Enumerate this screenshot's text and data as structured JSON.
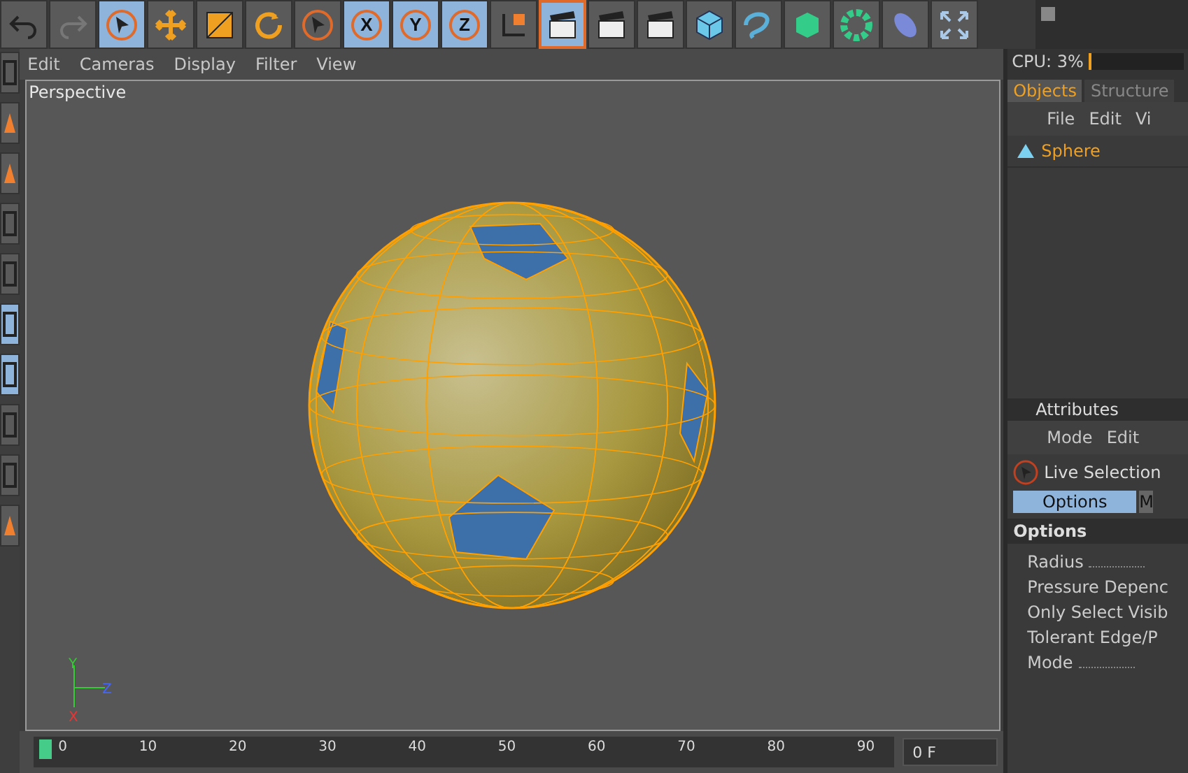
{
  "toolbar": {
    "buttons": [
      {
        "kind": "undo",
        "selected": false
      },
      {
        "kind": "redo",
        "selected": false
      },
      {
        "kind": "select",
        "selected": true
      },
      {
        "kind": "move",
        "selected": false
      },
      {
        "kind": "scale",
        "selected": false
      },
      {
        "kind": "rotate",
        "selected": false
      },
      {
        "kind": "select",
        "selected": false
      },
      {
        "kind": "axis-x",
        "selected": true,
        "label": "X"
      },
      {
        "kind": "axis-y",
        "selected": true,
        "label": "Y"
      },
      {
        "kind": "axis-z",
        "selected": true,
        "label": "Z"
      },
      {
        "kind": "coords",
        "selected": false
      },
      {
        "kind": "render",
        "selected": true
      },
      {
        "kind": "render",
        "selected": false
      },
      {
        "kind": "render",
        "selected": false
      },
      {
        "kind": "cube",
        "selected": false
      },
      {
        "kind": "spline",
        "selected": false
      },
      {
        "kind": "nurbs",
        "selected": false
      },
      {
        "kind": "array",
        "selected": false
      },
      {
        "kind": "deformer",
        "selected": false
      },
      {
        "kind": "expand",
        "selected": false
      }
    ]
  },
  "left_toolbar": {
    "buttons": [
      {
        "kind": "grid",
        "selected": false
      },
      {
        "kind": "cone",
        "selected": false
      },
      {
        "kind": "cone",
        "selected": false
      },
      {
        "kind": "grid",
        "selected": false
      },
      {
        "kind": "grid",
        "selected": false
      },
      {
        "kind": "grid",
        "selected": true
      },
      {
        "kind": "grid",
        "selected": true
      },
      {
        "kind": "grid",
        "selected": false
      },
      {
        "kind": "grid",
        "selected": false
      },
      {
        "kind": "cone",
        "selected": false
      }
    ]
  },
  "viewport": {
    "menu": [
      "Edit",
      "Cameras",
      "Display",
      "Filter",
      "View"
    ],
    "camera": "Perspective",
    "axes": [
      "Y",
      "Z",
      "X"
    ]
  },
  "timeline": {
    "ticks": [
      "0",
      "10",
      "20",
      "30",
      "40",
      "50",
      "60",
      "70",
      "80",
      "90"
    ],
    "current_frame": "0 F",
    "level": 0.0
  },
  "right_panel": {
    "cpu": {
      "label": "CPU: 3%",
      "level": 0.03
    },
    "objects": {
      "tabs": [
        {
          "label": "Objects",
          "selected": true
        },
        {
          "label": "Structure",
          "selected": false
        }
      ],
      "menu": [
        "File",
        "Edit",
        "Vi"
      ],
      "items": [
        {
          "name": "Sphere",
          "selected": true
        }
      ]
    },
    "attributes": {
      "title": "Attributes",
      "menu": [
        "Mode",
        "Edit"
      ],
      "tool": "Live Selection",
      "tabs": [
        {
          "label": "Options",
          "selected": true
        },
        {
          "label": "M",
          "selected": false
        }
      ],
      "section": "Options",
      "params": [
        {
          "label": "Radius",
          "dotted": true
        },
        {
          "label": "Pressure Depenc",
          "dotted": false
        },
        {
          "label": "Only Select Visib",
          "dotted": false
        },
        {
          "label": "Tolerant Edge/P",
          "dotted": false
        },
        {
          "label": "Mode",
          "dotted": true
        }
      ]
    }
  }
}
